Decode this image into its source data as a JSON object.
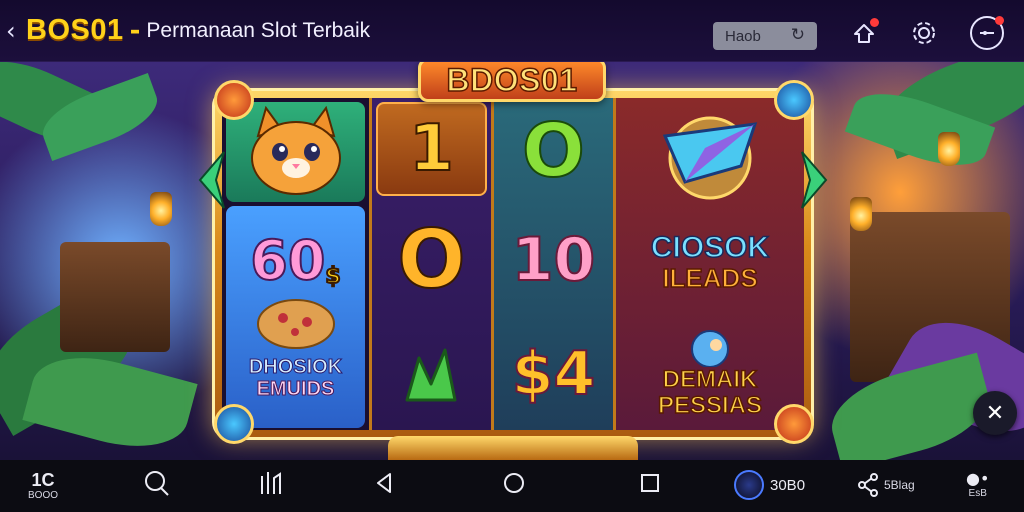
{
  "app_bar": {
    "back_icon": "chevron-left-icon",
    "brand": "BOS01",
    "separator": "-",
    "subtitle": "Permanaan Slot Terbaik",
    "search_text": "Haob",
    "reload_icon": "reload-icon",
    "icons": [
      "notification-icon",
      "settings-icon",
      "profile-icon"
    ]
  },
  "machine": {
    "marquee": "BDOS01",
    "reels": [
      {
        "symbols": [
          "cat-icon",
          "60 $ DHOSIOK EMUIDS"
        ]
      },
      {
        "symbols": [
          "1",
          "0",
          "crown-symbol-icon"
        ]
      },
      {
        "symbols": [
          "0",
          "10",
          "$4"
        ]
      },
      {
        "symbols": [
          "gem-icon",
          "CIOSOK ILEADS",
          "DEMAIK PESSIAS"
        ]
      }
    ],
    "cells": {
      "r1_bottom_num": "60",
      "r1_bottom_dollar": "$",
      "r1_bottom_text_1": "DHOSIOK",
      "r1_bottom_text_2": "EMUIDS",
      "r2_top": "1",
      "r2_mid": "O",
      "r3_top": "O",
      "r3_mid": "10",
      "r3_bottom": "$4",
      "r4_mid_1": "CIOSOK",
      "r4_mid_2": "ILEADS",
      "r4_bottom_1": "DEMAIK",
      "r4_bottom_2": "PESSIAS"
    }
  },
  "float_button": {
    "icon": "close-x-icon"
  },
  "navbar": {
    "logo_top": "1C",
    "logo_bottom": "BOOO",
    "items": [
      "search-icon",
      "library-icon",
      "back-triangle-icon",
      "home-circle-icon",
      "recents-square-icon"
    ],
    "coin_label": "30B0",
    "share_label": "5Blag",
    "more_label": "EsB"
  },
  "colors": {
    "brand_yellow": "#ffd21a",
    "frame_gold": "#d98a1a",
    "topbar": "#140a2e",
    "navbar": "#0c0c12"
  }
}
